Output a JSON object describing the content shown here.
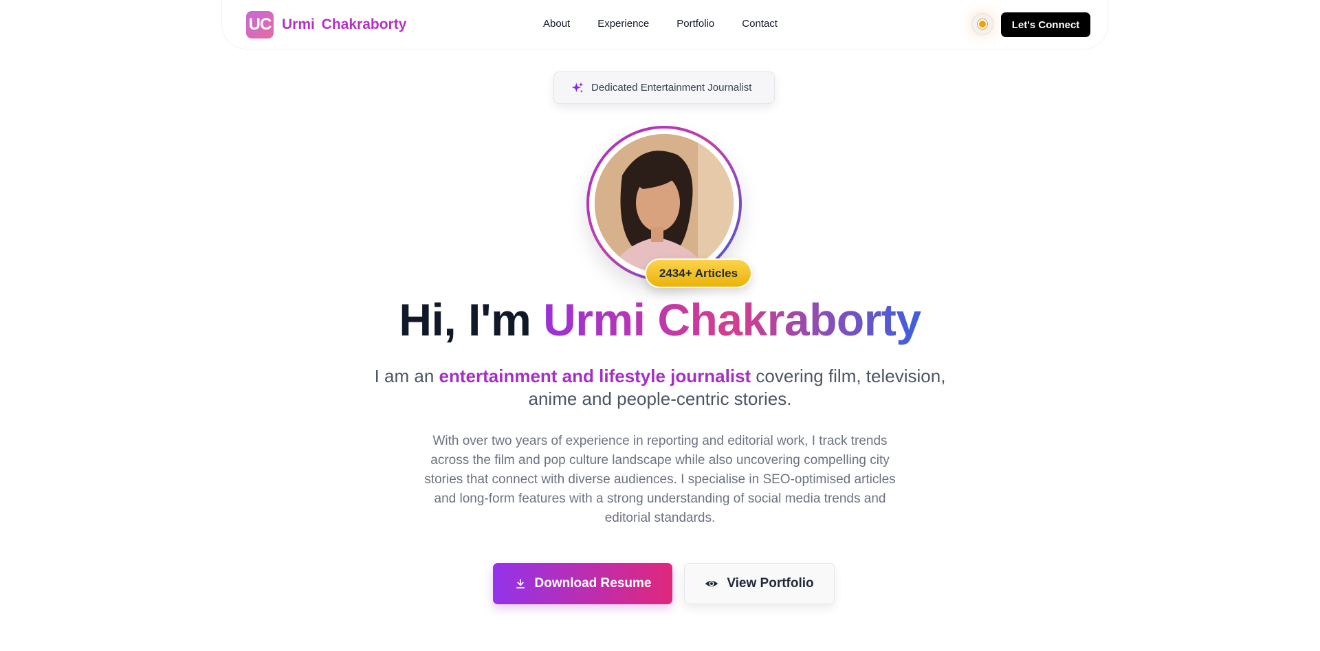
{
  "nav": {
    "logo_initials": "UC",
    "brand_name": "Urmi Chakraborty",
    "links": [
      {
        "label": "About"
      },
      {
        "label": "Experience"
      },
      {
        "label": "Portfolio"
      },
      {
        "label": "Contact"
      }
    ],
    "theme_toggle_icon": "sun-icon",
    "connect_label": "Let's Connect"
  },
  "hero": {
    "badge_icon": "sparkles-icon",
    "badge_text": "Dedicated Entertainment Journalist",
    "avatar_alt": "profile-photo",
    "articles_count": "2434+ Articles",
    "heading_prefix": "Hi, I'm",
    "heading_name": "Urmi Chakraborty",
    "tagline_prefix": "I am an",
    "tagline_highlight": "entertainment and lifestyle journalist",
    "tagline_suffix": "covering film, television, anime and people-centric stories.",
    "description": "With over two years of experience in reporting and editorial work, I track trends across the film and pop culture landscape while also uncovering compelling city stories that connect with diverse audiences. I specialise in SEO-optimised articles and long-form features with a strong understanding of social media trends and editorial standards.",
    "download_label": "Download Resume",
    "download_icon": "download-icon",
    "view_label": "View Portfolio",
    "view_icon": "eye-icon"
  },
  "colors": {
    "brand_purple": "#a42fc4",
    "brand_pink": "#e0287c",
    "brand_blue": "#3b5fe0",
    "badge_yellow": "#eab308",
    "connect_bg": "#000000"
  }
}
